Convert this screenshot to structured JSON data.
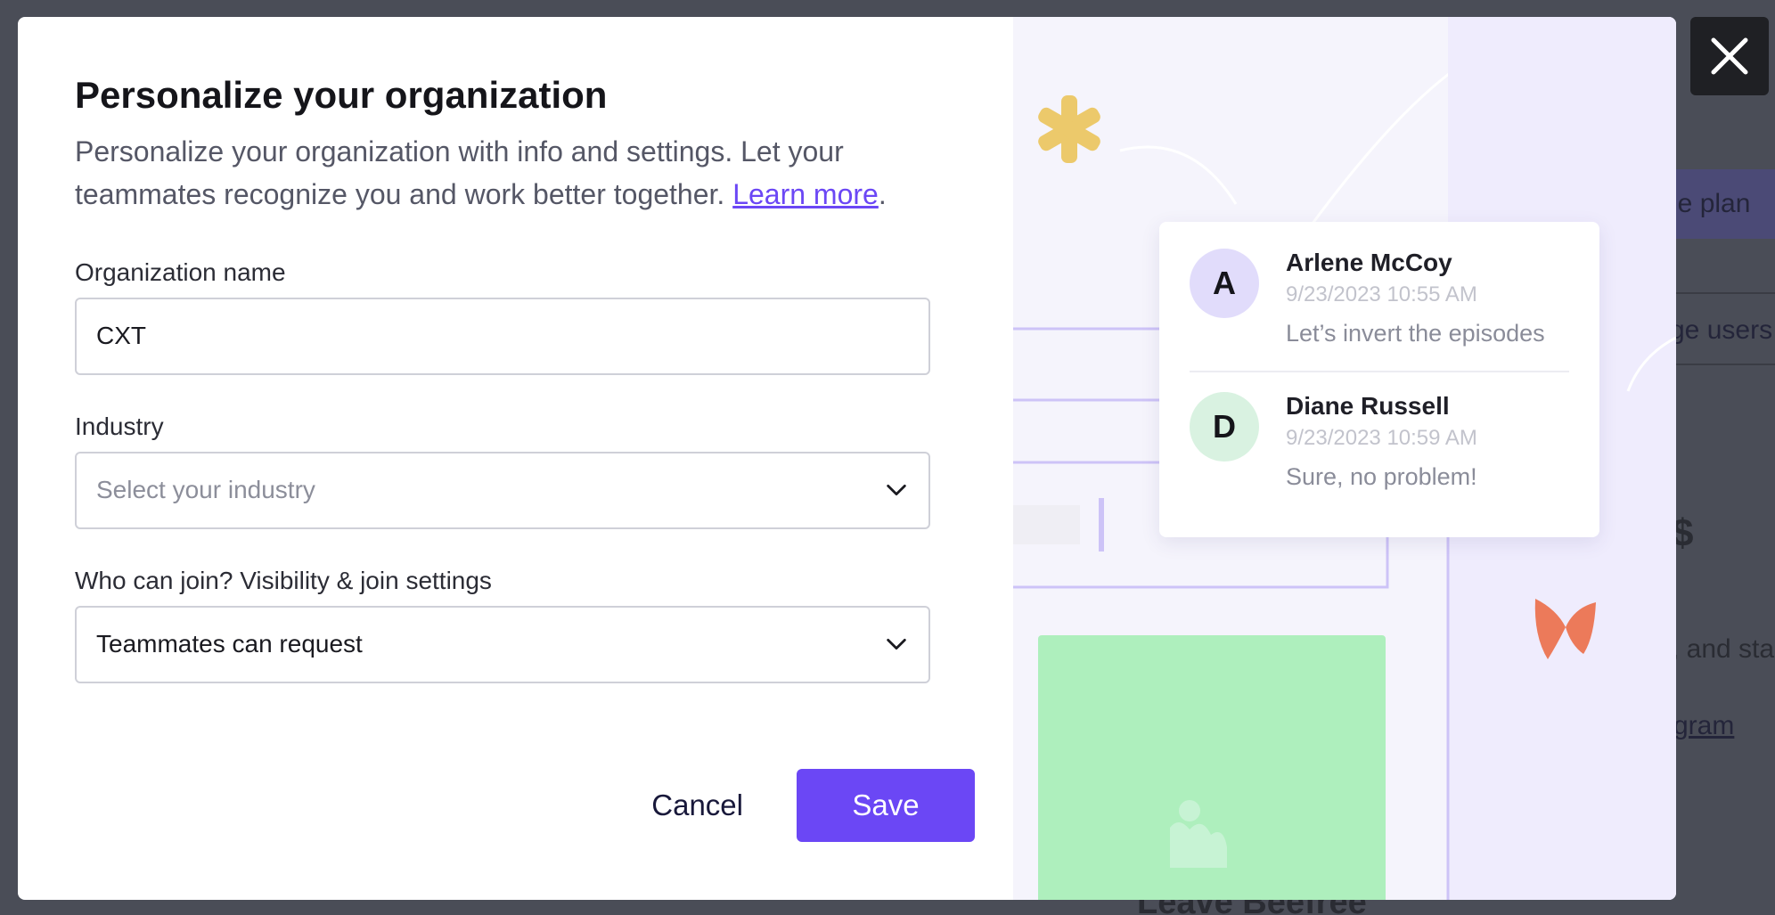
{
  "modal": {
    "title": "Personalize your organization",
    "description": "Personalize your organization with info and settings. Let your teammates recognize you and work better together. ",
    "learn_more_link": "Learn more",
    "period": ".",
    "org_name": {
      "label": "Organization name",
      "value": "CXT"
    },
    "industry": {
      "label": "Industry",
      "placeholder": "Select your industry"
    },
    "visibility": {
      "label": "Who can join? Visibility & join settings",
      "value": "Teammates can request"
    },
    "cancel_label": "Cancel",
    "save_label": "Save"
  },
  "comments": [
    {
      "initial": "A",
      "name": "Arlene McCoy",
      "time": "9/23/2023  10:55 AM",
      "text": "Let’s invert the episodes",
      "avatar_color": "#e1dcfb"
    },
    {
      "initial": "D",
      "name": "Diane Russell",
      "time": "9/23/2023  10:59 AM",
      "text": "Sure, no problem!",
      "avatar_color": "#d9f2e1"
    }
  ],
  "background": {
    "plan_text": "ge plan",
    "users_text": "ge users",
    "dollar_text": "$",
    "andsta_text": ", and sta",
    "gram_text": "gram",
    "leave_text": "Leave Beefree"
  },
  "colors": {
    "accent": "#6b47f5",
    "overlay": "#4a4d57"
  },
  "icons": {
    "close": "close-icon",
    "chevron": "chevron-down-icon"
  }
}
